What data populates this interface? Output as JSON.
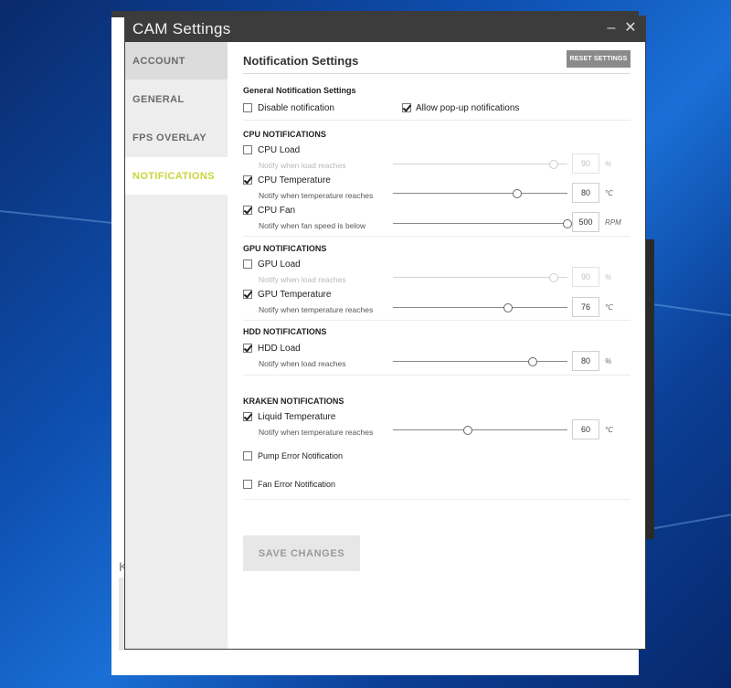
{
  "window": {
    "title": "CAM Settings",
    "minimize": "–",
    "close": "✕"
  },
  "sidebar": {
    "items": [
      {
        "label": "ACCOUNT"
      },
      {
        "label": "GENERAL"
      },
      {
        "label": "FPS OVERLAY"
      },
      {
        "label": "NOTIFICATIONS"
      }
    ],
    "active": "NOTIFICATIONS"
  },
  "header": {
    "title": "Notification Settings",
    "reset_label": "RESET SETTINGS"
  },
  "general": {
    "title": "General Notification Settings",
    "disable": {
      "label": "Disable notification",
      "checked": false
    },
    "popup": {
      "label": "Allow pop-up notifications",
      "checked": true
    }
  },
  "cpu": {
    "title": "CPU NOTIFICATIONS",
    "load": {
      "label": "CPU Load",
      "sub": "Notify when load reaches",
      "value": "90",
      "unit": "%",
      "fraction": 0.92,
      "checked": false
    },
    "temp": {
      "label": "CPU Temperature",
      "sub": "Notify when temperature reaches",
      "value": "80",
      "unit": "℃",
      "fraction": 0.71,
      "checked": true
    },
    "fan": {
      "label": "CPU Fan",
      "sub": "Notify when fan speed is below",
      "value": "500",
      "unit": "RPM",
      "fraction": 1.0,
      "checked": true
    }
  },
  "gpu": {
    "title": "GPU NOTIFICATIONS",
    "load": {
      "label": "GPU Load",
      "sub": "Notify when load reaches",
      "value": "90",
      "unit": "%",
      "fraction": 0.92,
      "checked": false
    },
    "temp": {
      "label": "GPU Temperature",
      "sub": "Notify when temperature reaches",
      "value": "76",
      "unit": "℃",
      "fraction": 0.66,
      "checked": true
    }
  },
  "hdd": {
    "title": "HDD NOTIFICATIONS",
    "load": {
      "label": "HDD Load",
      "sub": "Notify when load reaches",
      "value": "80",
      "unit": "%",
      "fraction": 0.8,
      "checked": true
    }
  },
  "kraken": {
    "title": "KRAKEN NOTIFICATIONS",
    "liquid": {
      "label": "Liquid Temperature",
      "sub": "Notify when temperature reaches",
      "value": "60",
      "unit": "℃",
      "fraction": 0.43,
      "checked": true
    },
    "pump": {
      "label": "Pump Error Notification",
      "checked": false
    },
    "fan": {
      "label": "Fan Error Notification",
      "checked": false
    }
  },
  "save_label": "SAVE CHANGES",
  "background": {
    "letter": "K"
  }
}
